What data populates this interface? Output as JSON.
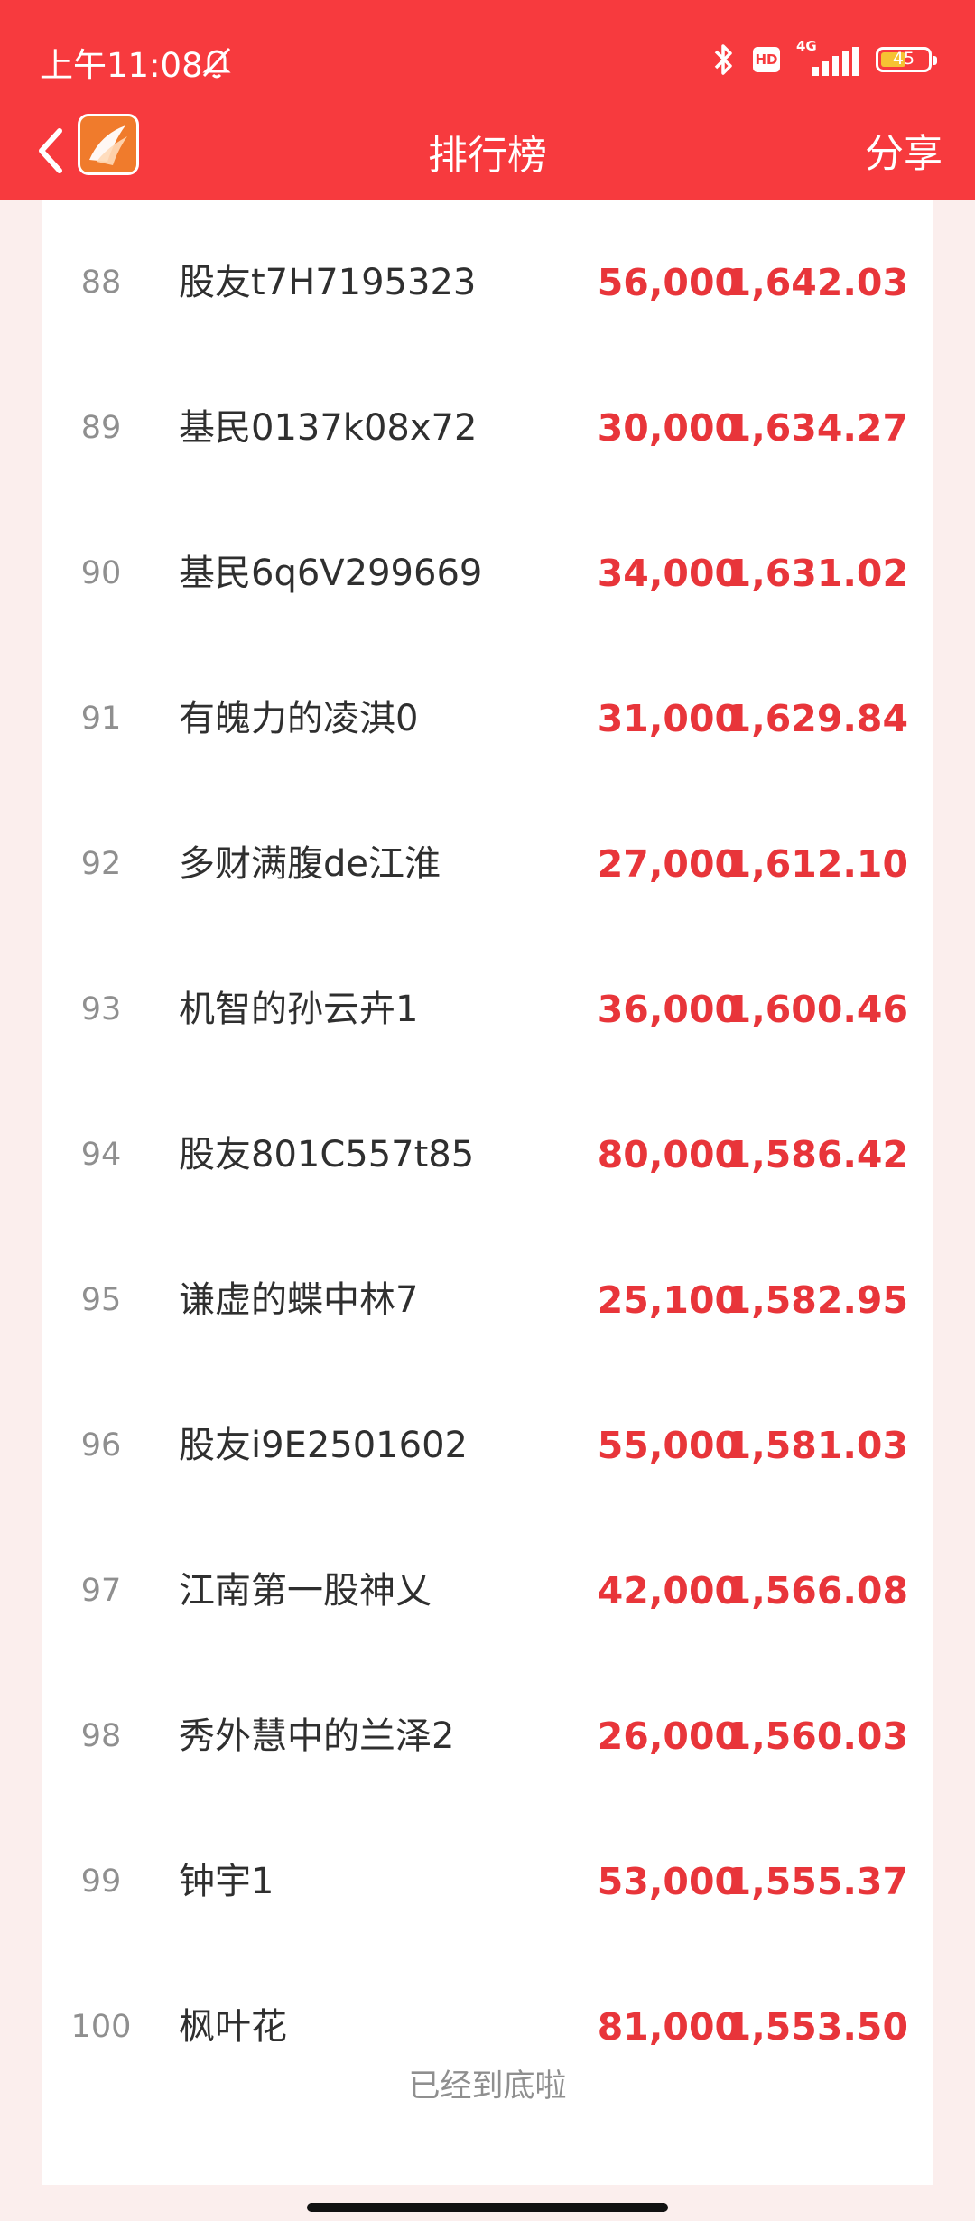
{
  "status_bar": {
    "time": "上午11:08",
    "network": "4G",
    "hd": "HD",
    "battery": "45"
  },
  "nav": {
    "title": "排行榜",
    "share": "分享"
  },
  "rows": [
    {
      "rank": "88",
      "name": "股友t7H7195323",
      "amount": "56,000",
      "value": "1,642.03"
    },
    {
      "rank": "89",
      "name": "基民0137k08x72",
      "amount": "30,000",
      "value": "1,634.27"
    },
    {
      "rank": "90",
      "name": "基民6q6V299669",
      "amount": "34,000",
      "value": "1,631.02"
    },
    {
      "rank": "91",
      "name": "有魄力的凌淇0",
      "amount": "31,000",
      "value": "1,629.84"
    },
    {
      "rank": "92",
      "name": "多财满腹de江淮",
      "amount": "27,000",
      "value": "1,612.10"
    },
    {
      "rank": "93",
      "name": "机智的孙云卉1",
      "amount": "36,000",
      "value": "1,600.46"
    },
    {
      "rank": "94",
      "name": "股友801C557t85",
      "amount": "80,000",
      "value": "1,586.42"
    },
    {
      "rank": "95",
      "name": "谦虚的蝶中林7",
      "amount": "25,100",
      "value": "1,582.95"
    },
    {
      "rank": "96",
      "name": "股友i9E2501602",
      "amount": "55,000",
      "value": "1,581.03"
    },
    {
      "rank": "97",
      "name": "江南第一股神乂",
      "amount": "42,000",
      "value": "1,566.08"
    },
    {
      "rank": "98",
      "name": "秀外慧中的兰泽2",
      "amount": "26,000",
      "value": "1,560.03"
    },
    {
      "rank": "99",
      "name": "钟宇1",
      "amount": "53,000",
      "value": "1,555.37"
    },
    {
      "rank": "100",
      "name": "枫叶花",
      "amount": "81,000",
      "value": "1,553.50"
    }
  ],
  "footer": {
    "end_text": "已经到底啦"
  },
  "colors": {
    "header": "#f73a3e",
    "accent_red": "#e8353a",
    "page_bg": "#fbeeed"
  }
}
